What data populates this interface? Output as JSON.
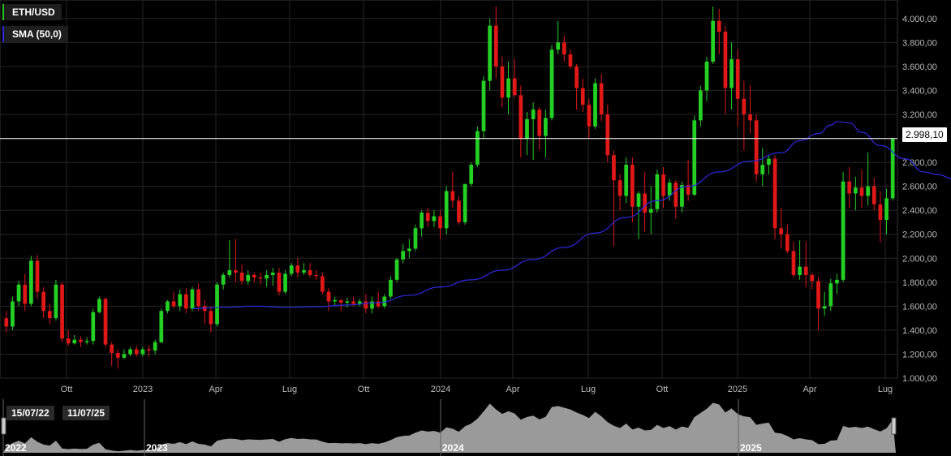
{
  "legend": {
    "symbol": "ETH/USD",
    "indicator": "SMA (50,0)"
  },
  "current_price_label": "2.998,10",
  "navigator": {
    "start_date": "15/07/22",
    "end_date": "11/07/25"
  },
  "colors": {
    "up": "#25d025",
    "down": "#e01818",
    "sma": "#2a2ae0",
    "background": "#000000",
    "grid": "#262626"
  },
  "chart_data": {
    "type": "candlestick",
    "interval": "weekly",
    "y_axis": {
      "range": [
        1000,
        4100
      ],
      "ticks": [
        "1.000,00",
        "1.200,00",
        "1.400,00",
        "1.600,00",
        "1.800,00",
        "2.000,00",
        "2.200,00",
        "2.400,00",
        "2.600,00",
        "2.800,00",
        "3.000,00",
        "3.200,00",
        "3.400,00",
        "3.600,00",
        "3.800,00",
        "4.000,00"
      ]
    },
    "x_tick_labels": [
      "Ott",
      "2023",
      "Apr",
      "Lug",
      "Ott",
      "2024",
      "Apr",
      "Lug",
      "Ott",
      "2025",
      "Apr",
      "Lug"
    ],
    "navigator_labels": [
      "2022",
      "2023",
      "2024",
      "2025"
    ],
    "current_price": 2998.1,
    "ohlc": [
      [
        1500,
        1560,
        1380,
        1430
      ],
      [
        1430,
        1680,
        1400,
        1640
      ],
      [
        1640,
        1810,
        1600,
        1780
      ],
      [
        1780,
        1870,
        1560,
        1620
      ],
      [
        1620,
        2020,
        1600,
        1980
      ],
      [
        1980,
        2030,
        1660,
        1720
      ],
      [
        1720,
        1760,
        1500,
        1560
      ],
      [
        1560,
        1620,
        1450,
        1500
      ],
      [
        1500,
        1820,
        1480,
        1780
      ],
      [
        1780,
        1800,
        1300,
        1330
      ],
      [
        1330,
        1400,
        1270,
        1290
      ],
      [
        1290,
        1360,
        1280,
        1320
      ],
      [
        1320,
        1350,
        1260,
        1300
      ],
      [
        1300,
        1340,
        1280,
        1310
      ],
      [
        1310,
        1580,
        1280,
        1550
      ],
      [
        1550,
        1680,
        1540,
        1660
      ],
      [
        1660,
        1670,
        1260,
        1280
      ],
      [
        1280,
        1300,
        1100,
        1210
      ],
      [
        1210,
        1240,
        1080,
        1170
      ],
      [
        1170,
        1240,
        1160,
        1200
      ],
      [
        1200,
        1260,
        1180,
        1240
      ],
      [
        1240,
        1270,
        1180,
        1200
      ],
      [
        1200,
        1260,
        1180,
        1240
      ],
      [
        1240,
        1270,
        1180,
        1230
      ],
      [
        1230,
        1320,
        1200,
        1300
      ],
      [
        1300,
        1580,
        1290,
        1560
      ],
      [
        1560,
        1650,
        1540,
        1640
      ],
      [
        1640,
        1720,
        1580,
        1600
      ],
      [
        1600,
        1740,
        1560,
        1700
      ],
      [
        1700,
        1750,
        1540,
        1580
      ],
      [
        1580,
        1760,
        1560,
        1740
      ],
      [
        1740,
        1790,
        1560,
        1600
      ],
      [
        1600,
        1650,
        1450,
        1560
      ],
      [
        1560,
        1600,
        1380,
        1450
      ],
      [
        1450,
        1800,
        1430,
        1780
      ],
      [
        1780,
        1880,
        1740,
        1860
      ],
      [
        1860,
        2150,
        1840,
        1900
      ],
      [
        1900,
        2160,
        1800,
        1880
      ],
      [
        1880,
        1950,
        1780,
        1810
      ],
      [
        1810,
        1900,
        1780,
        1860
      ],
      [
        1860,
        1880,
        1800,
        1840
      ],
      [
        1840,
        1880,
        1780,
        1830
      ],
      [
        1830,
        1900,
        1760,
        1860
      ],
      [
        1860,
        1920,
        1770,
        1880
      ],
      [
        1880,
        1920,
        1690,
        1720
      ],
      [
        1720,
        1900,
        1700,
        1870
      ],
      [
        1870,
        1960,
        1850,
        1940
      ],
      [
        1940,
        2000,
        1840,
        1880
      ],
      [
        1880,
        1960,
        1860,
        1900
      ],
      [
        1900,
        1960,
        1840,
        1860
      ],
      [
        1860,
        1900,
        1820,
        1850
      ],
      [
        1850,
        1880,
        1700,
        1720
      ],
      [
        1720,
        1750,
        1560,
        1640
      ],
      [
        1640,
        1680,
        1600,
        1650
      ],
      [
        1650,
        1660,
        1560,
        1630
      ],
      [
        1630,
        1670,
        1590,
        1640
      ],
      [
        1640,
        1680,
        1600,
        1620
      ],
      [
        1620,
        1660,
        1600,
        1640
      ],
      [
        1640,
        1700,
        1540,
        1580
      ],
      [
        1580,
        1680,
        1540,
        1640
      ],
      [
        1640,
        1720,
        1580,
        1600
      ],
      [
        1600,
        1700,
        1580,
        1680
      ],
      [
        1680,
        1850,
        1660,
        1820
      ],
      [
        1820,
        2000,
        1800,
        1990
      ],
      [
        1990,
        2120,
        1960,
        2060
      ],
      [
        2060,
        2160,
        2000,
        2080
      ],
      [
        2080,
        2280,
        2060,
        2250
      ],
      [
        2250,
        2400,
        2180,
        2380
      ],
      [
        2380,
        2420,
        2260,
        2310
      ],
      [
        2310,
        2400,
        2260,
        2350
      ],
      [
        2350,
        2400,
        2160,
        2250
      ],
      [
        2250,
        2600,
        2200,
        2560
      ],
      [
        2560,
        2720,
        2420,
        2480
      ],
      [
        2480,
        2520,
        2280,
        2300
      ],
      [
        2300,
        2600,
        2280,
        2620
      ],
      [
        2620,
        2800,
        2600,
        2780
      ],
      [
        2780,
        3100,
        2760,
        3060
      ],
      [
        3060,
        3520,
        3000,
        3480
      ],
      [
        3480,
        4000,
        3400,
        3940
      ],
      [
        3940,
        4100,
        3500,
        3600
      ],
      [
        3600,
        3680,
        3260,
        3340
      ],
      [
        3340,
        3640,
        3200,
        3500
      ],
      [
        3500,
        3660,
        3340,
        3360
      ],
      [
        3360,
        3440,
        2840,
        3000
      ],
      [
        3000,
        3220,
        2860,
        3160
      ],
      [
        3160,
        3300,
        2820,
        3240
      ],
      [
        3240,
        3260,
        2900,
        3020
      ],
      [
        3020,
        3240,
        2840,
        3170
      ],
      [
        3170,
        3780,
        3150,
        3740
      ],
      [
        3740,
        3980,
        3700,
        3800
      ],
      [
        3800,
        3860,
        3640,
        3700
      ],
      [
        3700,
        3740,
        3580,
        3600
      ],
      [
        3600,
        3620,
        3240,
        3420
      ],
      [
        3420,
        3500,
        3220,
        3280
      ],
      [
        3280,
        3330,
        3000,
        3100
      ],
      [
        3100,
        3500,
        3080,
        3460
      ],
      [
        3460,
        3540,
        3140,
        3200
      ],
      [
        3200,
        3280,
        2800,
        2860
      ],
      [
        2860,
        2900,
        2100,
        2650
      ],
      [
        2650,
        2700,
        2400,
        2520
      ],
      [
        2520,
        2840,
        2460,
        2780
      ],
      [
        2780,
        2840,
        2300,
        2430
      ],
      [
        2430,
        2560,
        2160,
        2540
      ],
      [
        2540,
        2720,
        2220,
        2380
      ],
      [
        2380,
        2600,
        2200,
        2410
      ],
      [
        2410,
        2740,
        2380,
        2700
      ],
      [
        2700,
        2760,
        2420,
        2520
      ],
      [
        2520,
        2660,
        2480,
        2630
      ],
      [
        2630,
        2650,
        2330,
        2430
      ],
      [
        2430,
        2640,
        2380,
        2610
      ],
      [
        2610,
        2820,
        2480,
        2530
      ],
      [
        2530,
        3190,
        2520,
        3150
      ],
      [
        3150,
        3440,
        3100,
        3400
      ],
      [
        3400,
        3680,
        3310,
        3640
      ],
      [
        3640,
        4100,
        3620,
        3980
      ],
      [
        3980,
        4080,
        3700,
        3890
      ],
      [
        3890,
        3940,
        3200,
        3420
      ],
      [
        3420,
        3800,
        3240,
        3660
      ],
      [
        3660,
        3740,
        3100,
        3330
      ],
      [
        3330,
        3480,
        2900,
        3200
      ],
      [
        3200,
        3440,
        3040,
        3150
      ],
      [
        3150,
        3200,
        2640,
        2700
      ],
      [
        2700,
        2920,
        2600,
        2780
      ],
      [
        2780,
        2860,
        2700,
        2830
      ],
      [
        2830,
        2860,
        2160,
        2250
      ],
      [
        2250,
        2420,
        2080,
        2200
      ],
      [
        2200,
        2280,
        2040,
        2060
      ],
      [
        2060,
        2140,
        1840,
        1860
      ],
      [
        1860,
        2150,
        1820,
        1930
      ],
      [
        1930,
        2140,
        1760,
        1860
      ],
      [
        1860,
        1880,
        1740,
        1810
      ],
      [
        1810,
        1840,
        1400,
        1580
      ],
      [
        1580,
        1720,
        1520,
        1600
      ],
      [
        1600,
        1830,
        1560,
        1790
      ],
      [
        1790,
        1870,
        1700,
        1820
      ],
      [
        1820,
        2720,
        1800,
        2640
      ],
      [
        2640,
        2760,
        2420,
        2540
      ],
      [
        2540,
        2680,
        2400,
        2590
      ],
      [
        2590,
        2740,
        2420,
        2520
      ],
      [
        2520,
        2880,
        2440,
        2600
      ],
      [
        2600,
        2670,
        2400,
        2450
      ],
      [
        2450,
        2560,
        2130,
        2320
      ],
      [
        2320,
        2580,
        2200,
        2500
      ],
      [
        2500,
        2940,
        2480,
        2998
      ]
    ],
    "sma": [
      [
        30,
        1580
      ],
      [
        35,
        1590
      ],
      [
        40,
        1600
      ],
      [
        45,
        1590
      ],
      [
        50,
        1595
      ],
      [
        55,
        1610
      ],
      [
        60,
        1630
      ],
      [
        65,
        1690
      ],
      [
        70,
        1760
      ],
      [
        75,
        1820
      ],
      [
        80,
        1900
      ],
      [
        85,
        1990
      ],
      [
        90,
        2090
      ],
      [
        95,
        2210
      ],
      [
        100,
        2340
      ],
      [
        105,
        2480
      ],
      [
        110,
        2600
      ],
      [
        115,
        2720
      ],
      [
        120,
        2810
      ],
      [
        125,
        2880
      ],
      [
        128,
        2980
      ],
      [
        131,
        3040
      ],
      [
        133,
        3110
      ],
      [
        134,
        3140
      ],
      [
        136,
        3130
      ],
      [
        138,
        3050
      ],
      [
        141,
        2940
      ],
      [
        145,
        2830
      ],
      [
        148,
        2720
      ],
      [
        150,
        2700
      ],
      [
        153,
        2660
      ]
    ]
  }
}
